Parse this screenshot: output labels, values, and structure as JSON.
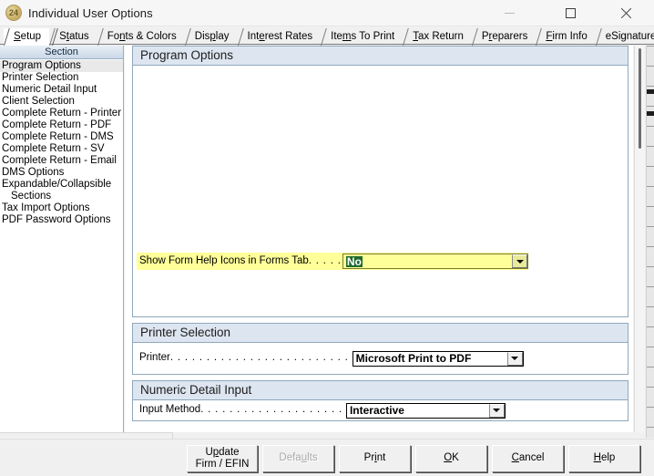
{
  "window": {
    "icon_label": "24",
    "icon_name": "app-badge-24-icon",
    "title": "Individual User Options",
    "controls": {
      "minimize": "–",
      "maximize": "□",
      "close": "✕"
    }
  },
  "tabs": [
    {
      "label": "Setup",
      "accel": "S",
      "active": true
    },
    {
      "label": "Status",
      "accel": "t",
      "active": false
    },
    {
      "label": "Fonts & Colors",
      "accel": "n",
      "active": false
    },
    {
      "label": "Display",
      "accel": "p",
      "active": false
    },
    {
      "label": "Interest Rates",
      "accel": "e",
      "active": false
    },
    {
      "label": "Items To Print",
      "accel": "m",
      "active": false
    },
    {
      "label": "Tax Return",
      "accel": "T",
      "active": false
    },
    {
      "label": "Preparers",
      "accel": "r",
      "active": false
    },
    {
      "label": "Firm Info",
      "accel": "F",
      "active": false
    },
    {
      "label": "eSignature",
      "accel": "",
      "active": false
    }
  ],
  "sidebar": {
    "header": "Section",
    "items": [
      {
        "label": "Program Options",
        "selected": true,
        "indent": false
      },
      {
        "label": "Printer Selection",
        "selected": false,
        "indent": false
      },
      {
        "label": "Numeric Detail Input",
        "selected": false,
        "indent": false
      },
      {
        "label": "Client Selection",
        "selected": false,
        "indent": false
      },
      {
        "label": "Complete Return - Printer",
        "selected": false,
        "indent": false
      },
      {
        "label": "Complete Return - PDF",
        "selected": false,
        "indent": false
      },
      {
        "label": "Complete Return - DMS",
        "selected": false,
        "indent": false
      },
      {
        "label": "Complete Return - SV",
        "selected": false,
        "indent": false
      },
      {
        "label": "Complete Return - Email",
        "selected": false,
        "indent": false
      },
      {
        "label": "DMS Options",
        "selected": false,
        "indent": false
      },
      {
        "label": "Expandable/Collapsible",
        "selected": false,
        "indent": false
      },
      {
        "label": "Sections",
        "selected": false,
        "indent": true
      },
      {
        "label": "Tax Import Options",
        "selected": false,
        "indent": false
      },
      {
        "label": "PDF Password Options",
        "selected": false,
        "indent": false
      }
    ]
  },
  "content": {
    "program_options": {
      "title": "Program Options",
      "show_help_icons": {
        "label": "Show Form Help Icons in Forms Tab",
        "leader": ". . . . .",
        "value": "No",
        "highlighted": true,
        "selected_text": true
      }
    },
    "printer_selection": {
      "title": "Printer Selection",
      "printer": {
        "label": "Printer",
        "leader": ". . . . . . . . . . . . . . . . . . . . . . . . .",
        "value": "Microsoft Print to PDF"
      }
    },
    "numeric_detail_input": {
      "title": "Numeric Detail Input",
      "input_method": {
        "label": "Input Method",
        "leader": ". . . . . . . . . . . . . . . . . . . .",
        "value": "Interactive"
      }
    }
  },
  "buttons": [
    {
      "label": "Update\nFirm / EFIN",
      "accel": "p",
      "disabled": false,
      "name": "update-firm-efin-button"
    },
    {
      "label": "Defaults",
      "accel": "u",
      "disabled": true,
      "name": "defaults-button"
    },
    {
      "label": "Print",
      "accel": "i",
      "disabled": false,
      "name": "print-button"
    },
    {
      "label": "OK",
      "accel": "O",
      "disabled": false,
      "name": "ok-button"
    },
    {
      "label": "Cancel",
      "accel": "C",
      "disabled": false,
      "name": "cancel-button"
    },
    {
      "label": "Help",
      "accel": "H",
      "disabled": false,
      "name": "help-button"
    }
  ],
  "colors": {
    "highlight_yellow": "#ffff99",
    "selection_green": "#1f6b2f",
    "group_header_blue": "#dde6f0",
    "group_border": "#8fa8bd",
    "sidebar_header_blue": "#c9d8e8"
  }
}
